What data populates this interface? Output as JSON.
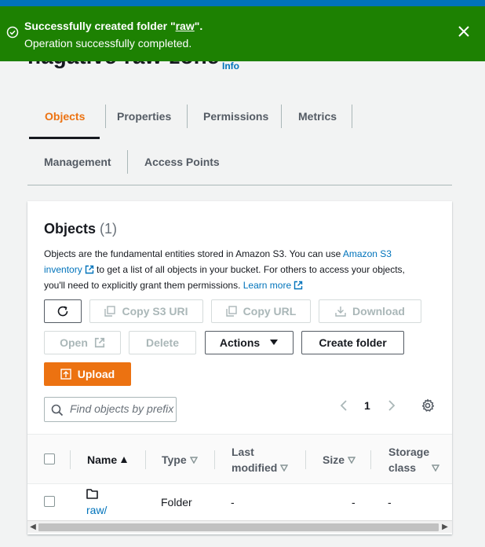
{
  "flash": {
    "title_prefix": "Successfully created folder \"",
    "folder": "raw",
    "title_suffix": "\".",
    "message": "Operation successfully completed."
  },
  "bucket": {
    "name": "nagative-raw-zone",
    "info": "Info"
  },
  "tabs": [
    {
      "label": "Objects",
      "active": true
    },
    {
      "label": "Properties"
    },
    {
      "label": "Permissions"
    },
    {
      "label": "Metrics"
    },
    {
      "label": "Management"
    },
    {
      "label": "Access Points"
    }
  ],
  "panel": {
    "title": "Objects",
    "count": "(1)",
    "desc1": "Objects are the fundamental entities stored in Amazon S3. You can use ",
    "inventory_link": "Amazon S3 inventory",
    "desc2": " to get a list of all objects in your bucket. For others to access your objects, you'll need to explicitly grant them permissions. ",
    "learn_more": "Learn more"
  },
  "toolbar": {
    "copy_s3_uri": "Copy S3 URI",
    "copy_url": "Copy URL",
    "download": "Download",
    "open": "Open",
    "delete": "Delete",
    "actions": "Actions",
    "create_folder": "Create folder",
    "upload": "Upload"
  },
  "search": {
    "placeholder": "Find objects by prefix"
  },
  "pagination": {
    "page": "1"
  },
  "table": {
    "headers": {
      "name": "Name",
      "type": "Type",
      "last_modified_1": "Last",
      "last_modified_2": "modified",
      "size": "Size",
      "storage_class_1": "Storage",
      "storage_class_2": "class"
    },
    "rows": [
      {
        "name": "raw/",
        "type": "Folder",
        "last_modified": "-",
        "size": "-",
        "storage_class": "-"
      }
    ]
  },
  "colors": {
    "success": "#1d8102",
    "accent": "#ec7211",
    "link": "#0073bb"
  }
}
